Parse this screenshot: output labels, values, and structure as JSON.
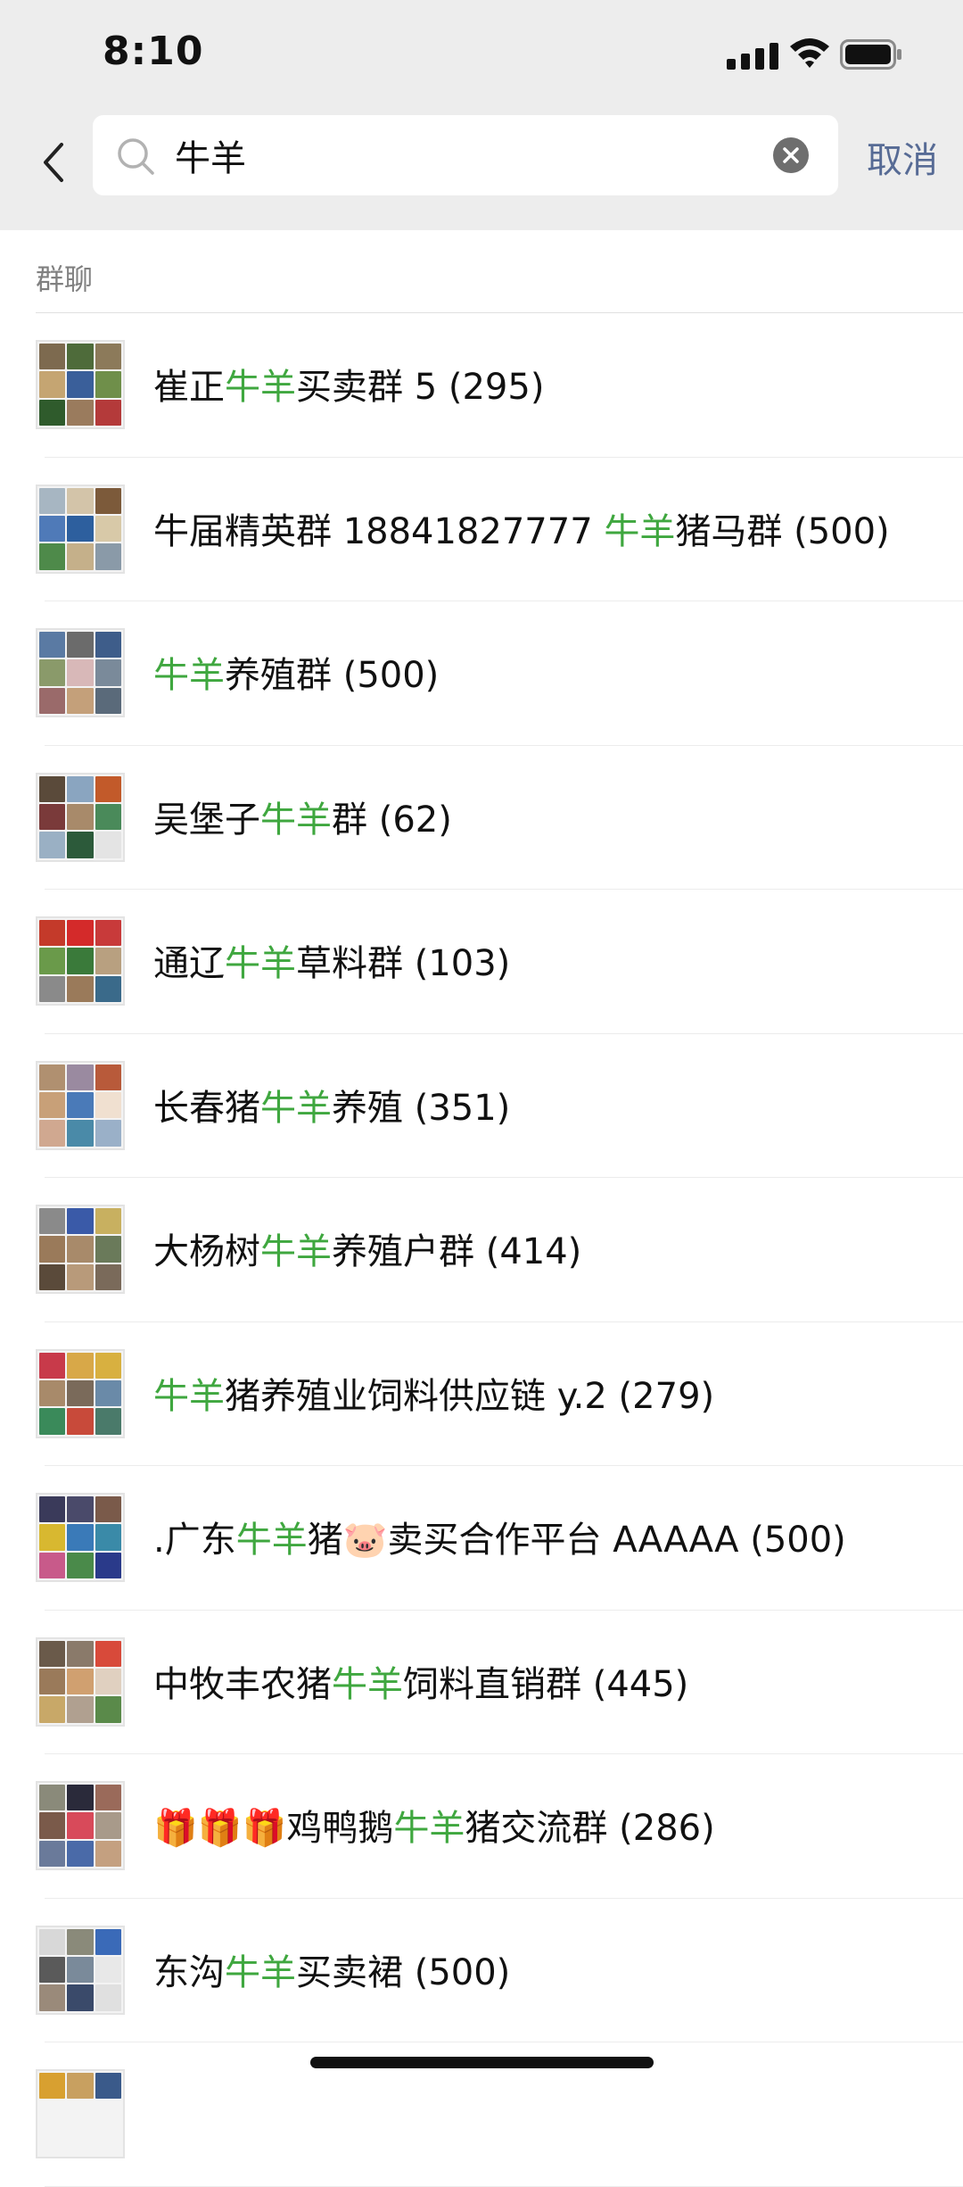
{
  "status_bar": {
    "time": "8:10"
  },
  "search": {
    "query": "牛羊",
    "cancel_label": "取消"
  },
  "section": {
    "title": "群聊"
  },
  "colors": {
    "highlight": "#3fa73f",
    "link": "#576b95"
  },
  "results": [
    {
      "before": "崔正",
      "match": "牛羊",
      "after": "买卖群 5 (295)",
      "avatar": [
        "#7d6a4f",
        "#4e6b3a",
        "#8c7a5a",
        "#c5a572",
        "#3a5f9a",
        "#6f8f4a",
        "#2f5b2c",
        "#9a7b5d",
        "#b43a3a"
      ]
    },
    {
      "before": "牛届精英群 18841827777 ",
      "match": "牛羊",
      "after": "猪马群 (500)",
      "avatar": [
        "#a7b6c2",
        "#d3c4a9",
        "#7c5a3a",
        "#4f7ab8",
        "#2d5f9e",
        "#d8c9a8",
        "#4e8a4a",
        "#c5b08a",
        "#8a9aa8"
      ]
    },
    {
      "before": "",
      "match": "牛羊",
      "after": "养殖群 (500)",
      "avatar": [
        "#5a7aa3",
        "#6b6b6b",
        "#3e5d8a",
        "#8a9a6a",
        "#d8b8b8",
        "#7a8a9a",
        "#9a6a6a",
        "#c4a07a",
        "#5a6a7a"
      ]
    },
    {
      "before": "吴堡子",
      "match": "牛羊",
      "after": "群 (62)",
      "avatar": [
        "#5a4a3a",
        "#8aa5c0",
        "#c25a2a",
        "#7a3a3a",
        "#a88a6a",
        "#4a8a5a",
        "#9ab0c4",
        "#2c5a3a",
        "#e4e4e4"
      ]
    },
    {
      "before": "通辽",
      "match": "牛羊",
      "after": "草料群 (103)",
      "avatar": [
        "#c43a2a",
        "#d42a2a",
        "#c83a3a",
        "#6a9a4a",
        "#3a7a3a",
        "#b8a080",
        "#8a8a8a",
        "#9a7a5a",
        "#3a6a8a"
      ]
    },
    {
      "before": "长春猪",
      "match": "牛羊",
      "after": "养殖 (351)",
      "avatar": [
        "#b09070",
        "#9a8aa0",
        "#b85a3a",
        "#c8a078",
        "#4a7ab8",
        "#f0e0d0",
        "#d0a890",
        "#4a8aa8",
        "#9ab0c8"
      ]
    },
    {
      "before": "大杨树",
      "match": "牛羊",
      "after": "养殖户群 (414)",
      "avatar": [
        "#8a8a8a",
        "#3a5aa8",
        "#c8b060",
        "#9a7a5a",
        "#a88a6a",
        "#6a7a5a",
        "#5a4a3a",
        "#b89a7a",
        "#7a6a5a"
      ]
    },
    {
      "before": "",
      "match": "牛羊",
      "after": "猪养殖业饲料供应链 y.2 (279)",
      "avatar": [
        "#c83a4a",
        "#d8a848",
        "#d8b040",
        "#a88a6a",
        "#7a6a5a",
        "#6a8aa8",
        "#3a8a5a",
        "#c84a3a",
        "#4a7a6a"
      ]
    },
    {
      "before": ".广东",
      "match": "牛羊",
      "after": "猪🐷卖买合作平台 AAAAA (500)",
      "avatar": [
        "#3a3a5a",
        "#4a4a6a",
        "#7a5a4a",
        "#d8b830",
        "#3a7ab8",
        "#3a8aa8",
        "#c85a8a",
        "#4a8a4a",
        "#2a3a8a"
      ]
    },
    {
      "before": "中牧丰农猪",
      "match": "牛羊",
      "after": "饲料直销群 (445)",
      "avatar": [
        "#6a5a4a",
        "#8a7a6a",
        "#d84a3a",
        "#9a7a5a",
        "#d0a070",
        "#e0d0c0",
        "#c8a868",
        "#b0a090",
        "#5a8a4a"
      ]
    },
    {
      "before": "🎁🎁🎁鸡鸭鹅",
      "match": "牛羊",
      "after": "猪交流群 (286)",
      "avatar": [
        "#8a8a7a",
        "#2a2a3a",
        "#9a6a5a",
        "#7a5a4a",
        "#d84a5a",
        "#a89a8a",
        "#6a7a9a",
        "#4a6aa8",
        "#c4a080"
      ]
    },
    {
      "before": "东沟",
      "match": "牛羊",
      "after": "买卖裙 (500)",
      "avatar": [
        "#d8d8d8",
        "#8a8a7a",
        "#3a6ab8",
        "#5a5a5a",
        "#7a8a9a",
        "#e8e8e8",
        "#9a8a7a",
        "#3a4a6a",
        "#e0e0e0"
      ]
    },
    {
      "before": "",
      "match": "",
      "after": "",
      "avatar": [
        "#d8a030",
        "#c8a060",
        "#3a5a8a",
        "",
        "",
        "",
        "",
        "",
        ""
      ]
    }
  ]
}
